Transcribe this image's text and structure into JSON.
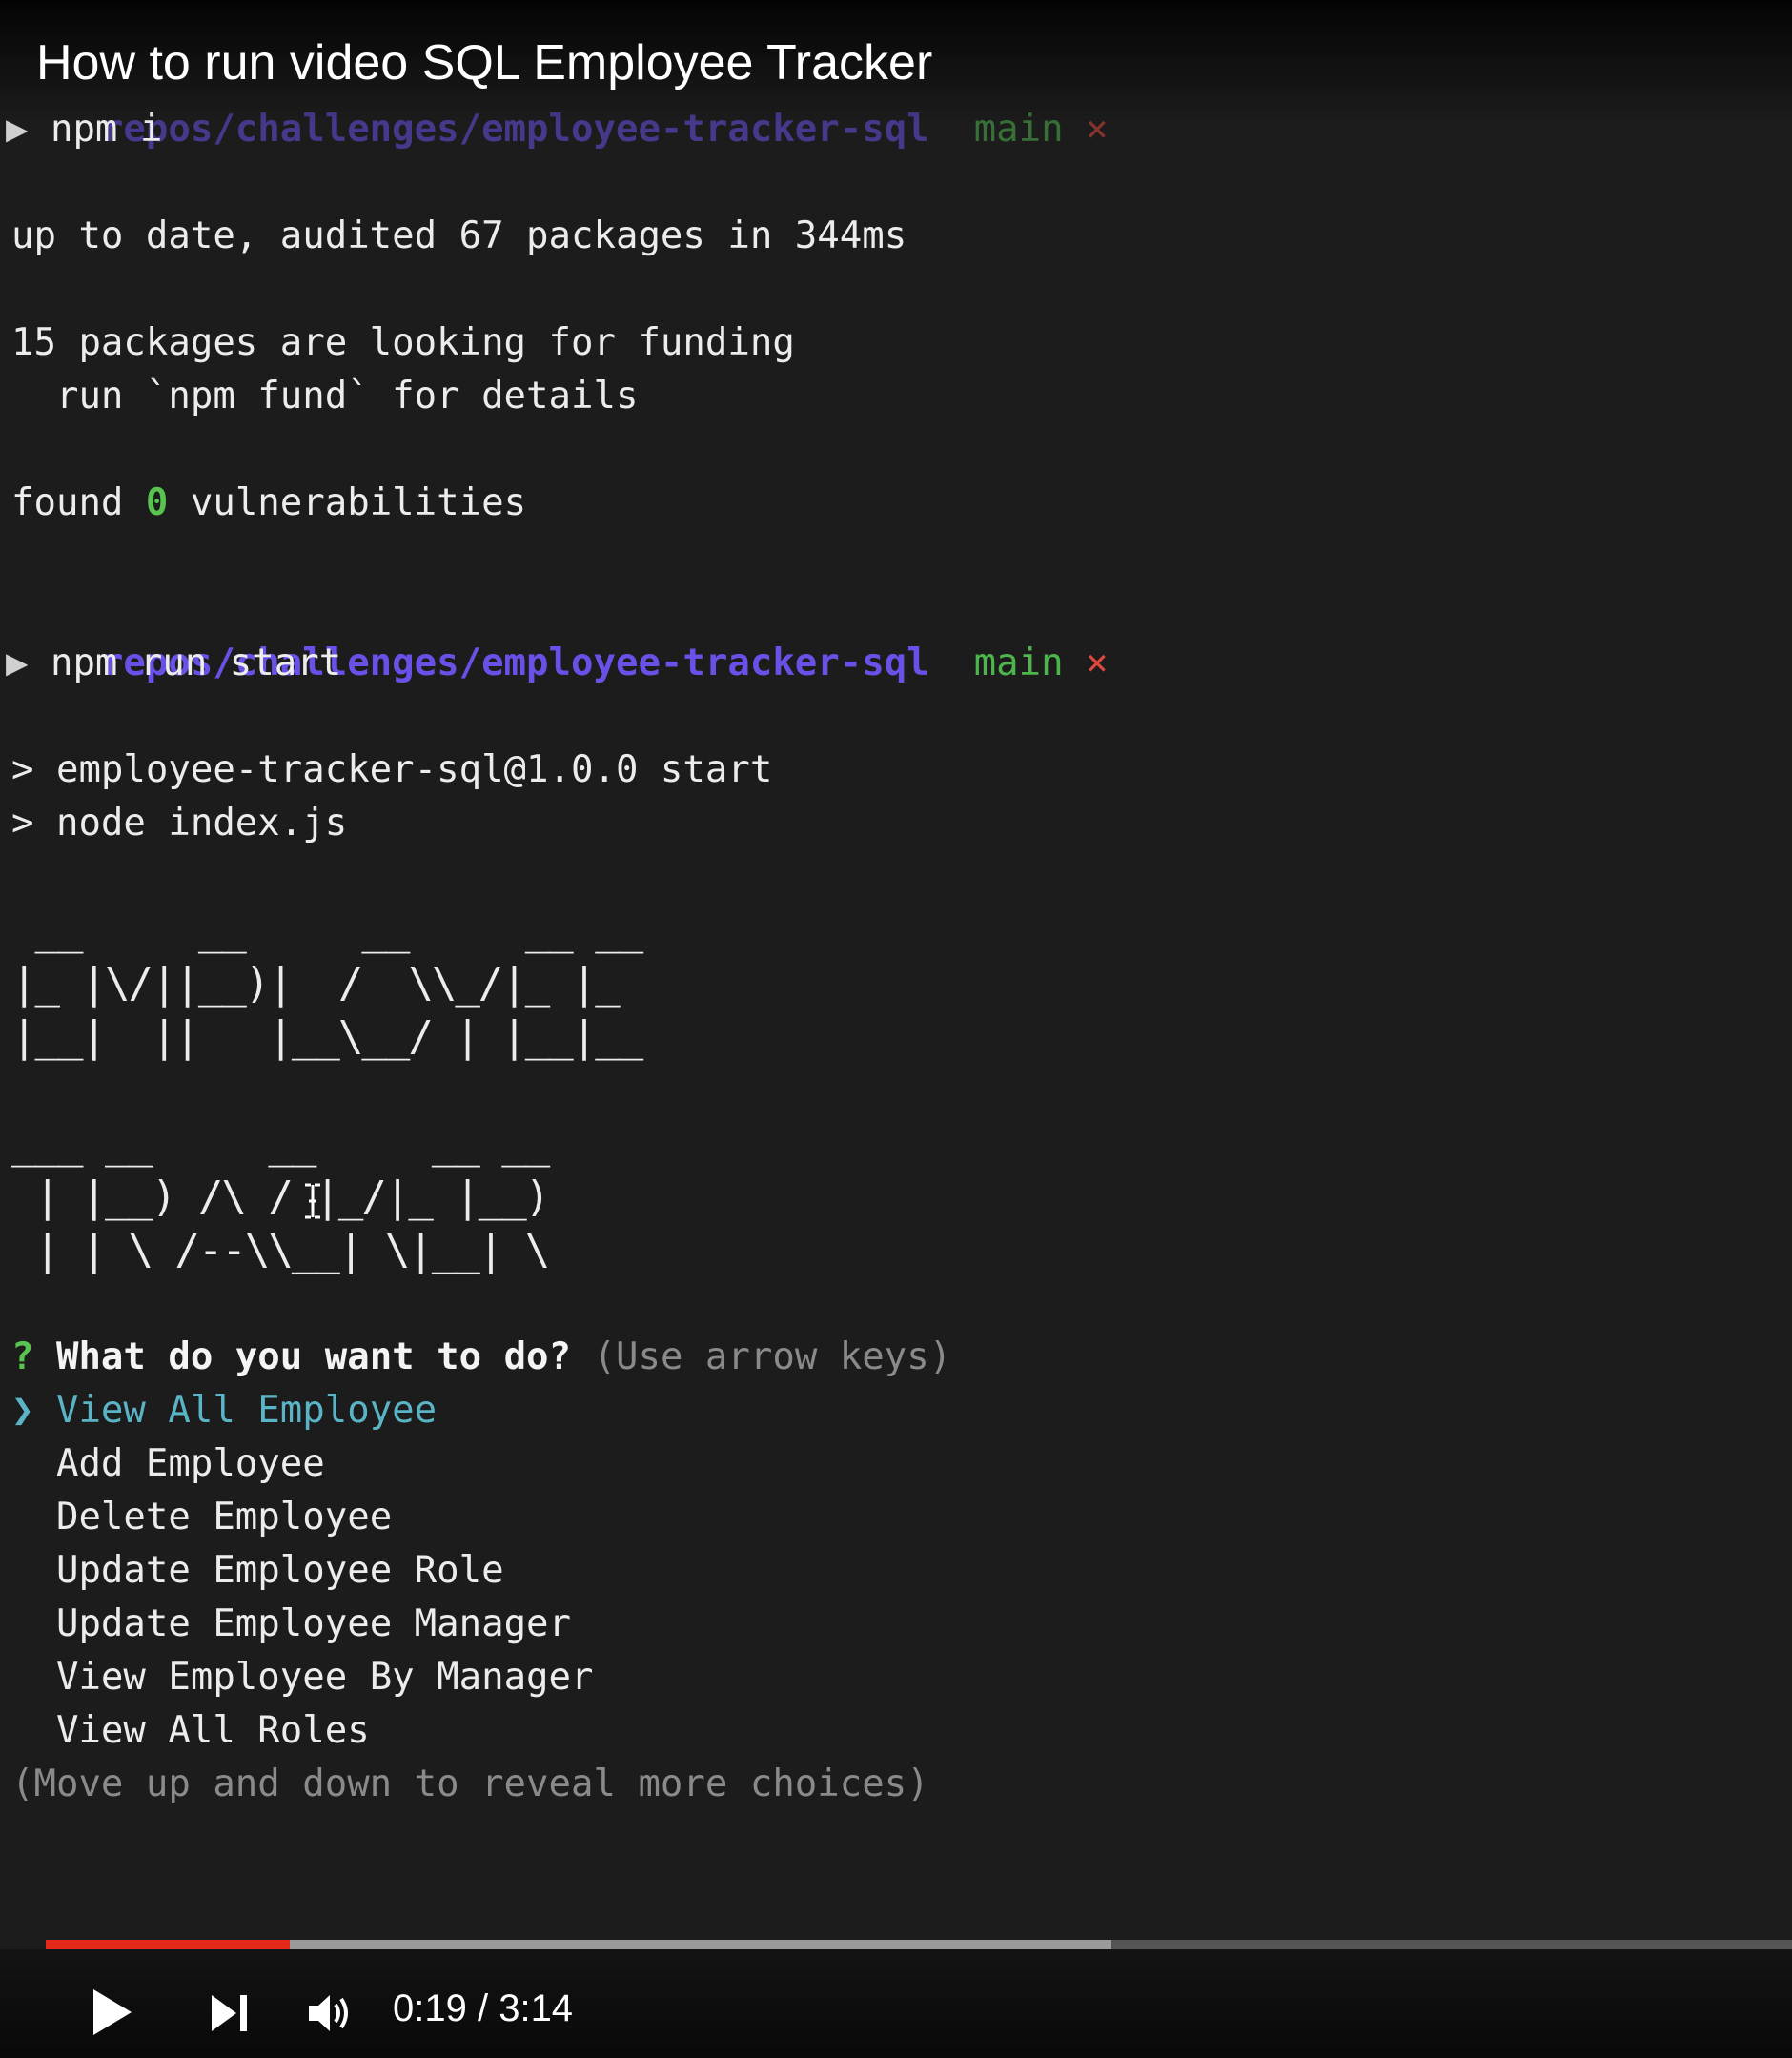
{
  "video": {
    "title": "How to run video SQL Employee Tracker",
    "time_current": "0:19",
    "time_sep": " / ",
    "time_total": "3:14",
    "progress_played": 0.14,
    "progress_buffered": 0.61,
    "icons": [
      "play-icon",
      "next-icon",
      "volume-icon"
    ]
  },
  "terminal": {
    "prompt_path": "repos/challenges/employee-tracker-sql",
    "prompt_branch": "main",
    "prompt_dirty": "×",
    "prompt_symbol": "▶",
    "cmd1": "npm i",
    "out1": "up to date, audited 67 packages in 344ms",
    "out2": "15 packages are looking for funding",
    "out3": "  run `npm fund` for details",
    "out4_pre": "found ",
    "out4_zero": "0",
    "out4_post": " vulnerabilities",
    "cmd2": "npm run start",
    "out5": "> employee-tracker-sql@1.0.0 start",
    "out6": "> node index.js",
    "ascii": [
      " __     __     __     __ __",
      "|_ |\\/||__)|  /  \\\\_/|_ |_",
      "|__|  ||   |__\\__/ | |__|__",
      "",
      "",
      "___ __     __     __ __",
      " | |__) /\\ / |_/|_ |__)",
      " | | \\ /--\\\\__| \\|__| \\"
    ],
    "question_mark": "?",
    "question": "What do you want to do?",
    "question_hint": "(Use arrow keys)",
    "pointer": "❯",
    "choices": [
      "View All Employee",
      "Add Employee",
      "Delete Employee",
      "Update Employee Role",
      "Update Employee Manager",
      "View Employee By Manager",
      "View All Roles"
    ],
    "more_hint": "(Move up and down to reveal more choices)"
  },
  "colors": {
    "path": "#6b50e8",
    "branch": "#4cb64c",
    "dirty": "#e0473c",
    "selected": "#5ab4c6",
    "progress": "#e3281c"
  }
}
